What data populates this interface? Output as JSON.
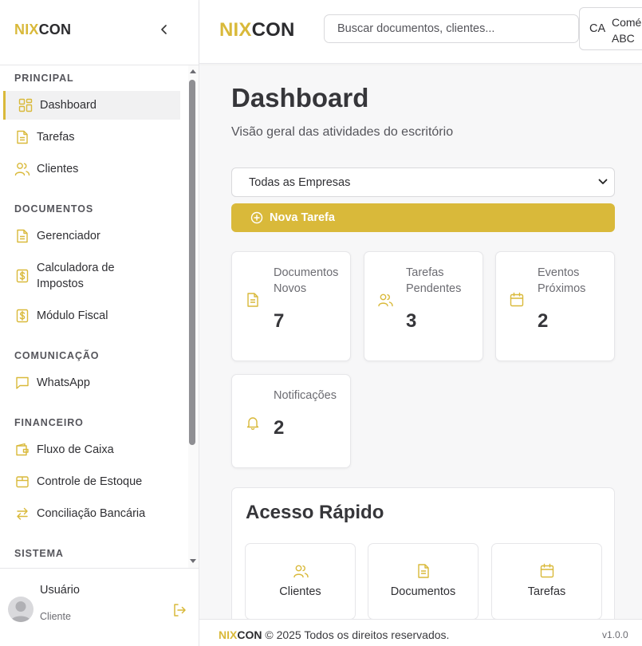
{
  "brand": {
    "part1": "NIX",
    "part2": "CON"
  },
  "colors": {
    "accent": "#d9b93a",
    "text": "#2f2f33",
    "muted": "#6c6c72"
  },
  "sidebar": {
    "sections": [
      {
        "title": "PRINCIPAL",
        "items": [
          {
            "label": "Dashboard",
            "icon": "dashboard-grid-icon",
            "active": true
          },
          {
            "label": "Tarefas",
            "icon": "document-icon"
          },
          {
            "label": "Clientes",
            "icon": "users-icon"
          }
        ]
      },
      {
        "title": "DOCUMENTOS",
        "items": [
          {
            "label": "Gerenciador",
            "icon": "document-icon"
          },
          {
            "label": "Calculadora de Impostos",
            "icon": "dollar-icon"
          },
          {
            "label": "Módulo Fiscal",
            "icon": "dollar-icon"
          }
        ]
      },
      {
        "title": "COMUNICAÇÃO",
        "items": [
          {
            "label": "WhatsApp",
            "icon": "message-icon"
          }
        ]
      },
      {
        "title": "FINANCEIRO",
        "items": [
          {
            "label": "Fluxo de Caixa",
            "icon": "wallet-icon"
          },
          {
            "label": "Controle de Estoque",
            "icon": "package-icon"
          },
          {
            "label": "Conciliação Bancária",
            "icon": "swap-arrows-icon"
          }
        ]
      },
      {
        "title": "SISTEMA",
        "items": []
      }
    ],
    "user": {
      "name": "Usuário",
      "role": "Cliente"
    }
  },
  "topbar": {
    "search_placeholder": "Buscar documentos, clientes...",
    "company": {
      "abbr": "CA",
      "name": "Comé ABC"
    }
  },
  "main": {
    "title": "Dashboard",
    "subtitle": "Visão geral das atividades do escritório",
    "filter_value": "Todas as Empresas",
    "new_task_label": "Nova Tarefa",
    "stats": [
      {
        "label": "Documentos Novos",
        "value": "7",
        "icon": "document-icon"
      },
      {
        "label": "Tarefas Pendentes",
        "value": "3",
        "icon": "users-icon"
      },
      {
        "label": "Eventos Próximos",
        "value": "2",
        "icon": "calendar-icon"
      },
      {
        "label": "Notificações",
        "value": "2",
        "icon": "bell-icon"
      }
    ],
    "quick_access": {
      "title": "Acesso Rápido",
      "items": [
        {
          "label": "Clientes",
          "icon": "users-icon"
        },
        {
          "label": "Documentos",
          "icon": "document-icon"
        },
        {
          "label": "Tarefas",
          "icon": "calendar-icon"
        }
      ]
    }
  },
  "footer": {
    "copyright": "© 2025 Todos os direitos reservados.",
    "version": "v1.0.0"
  }
}
